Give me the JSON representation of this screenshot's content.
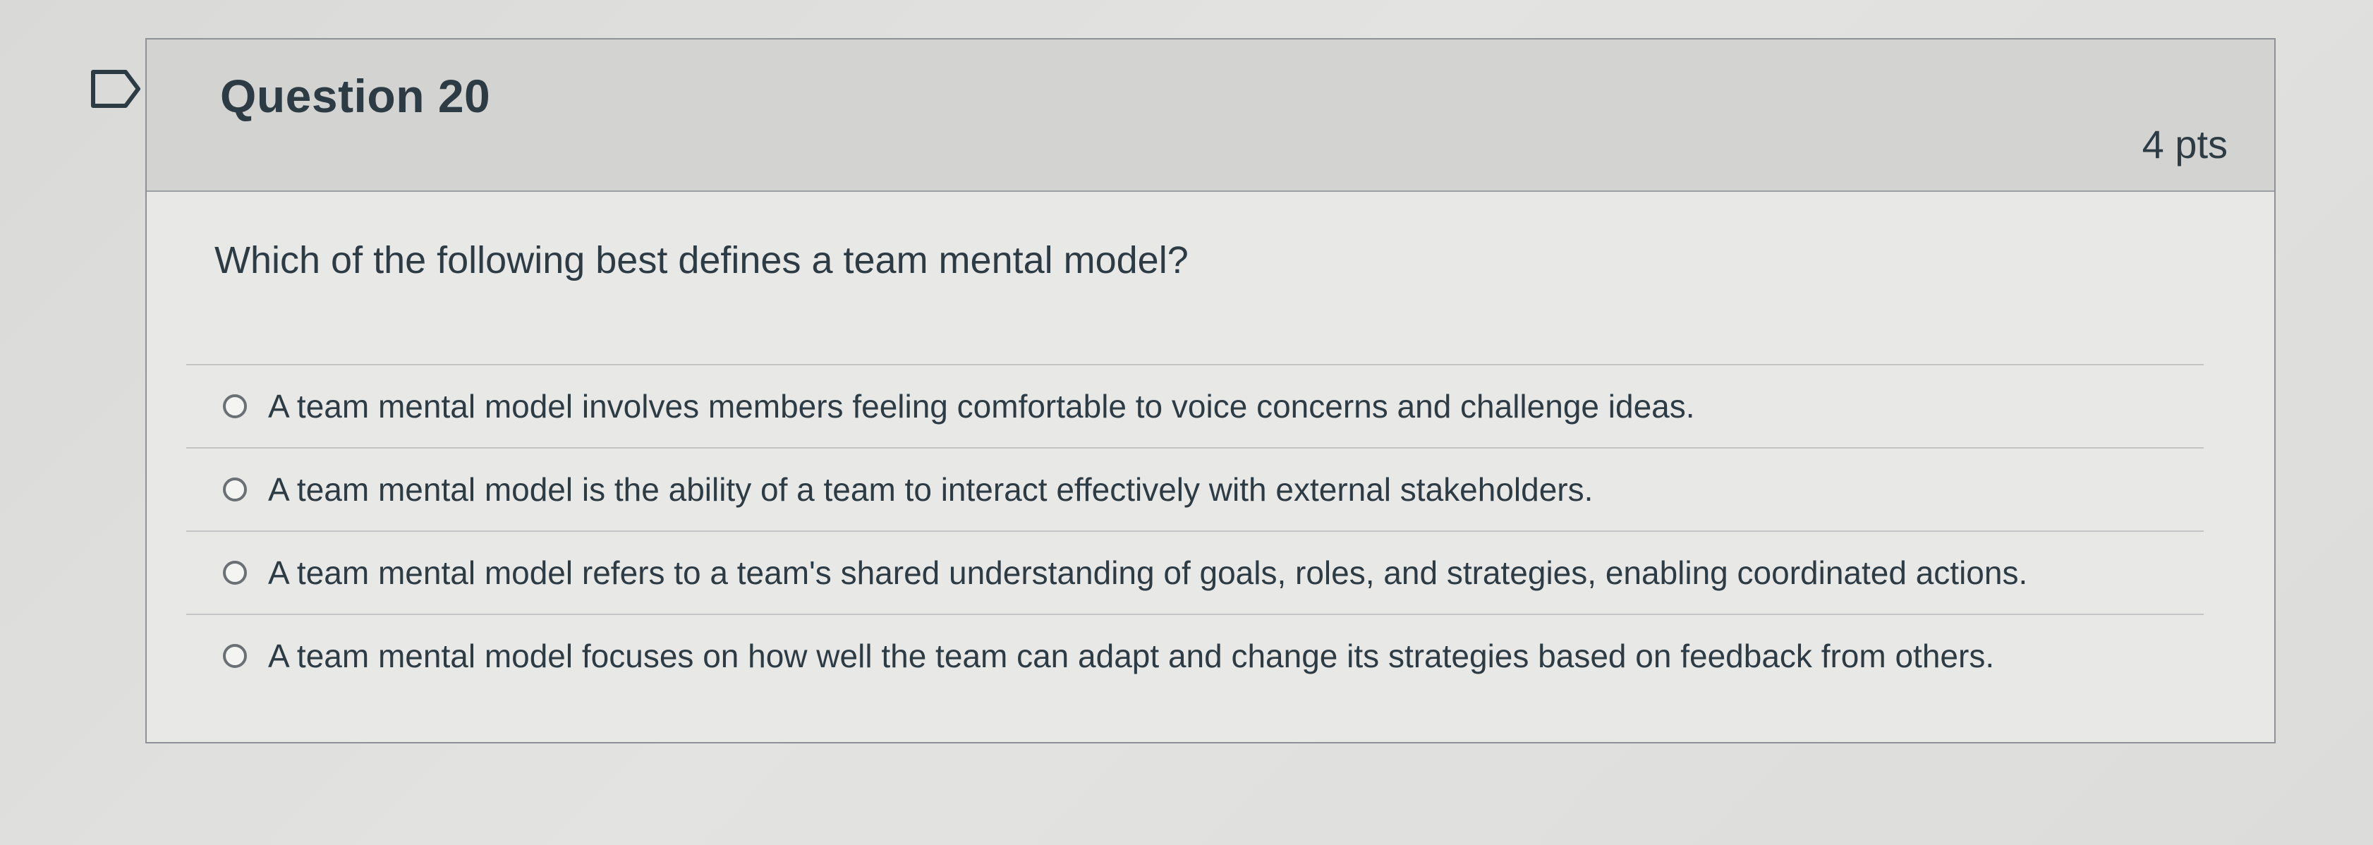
{
  "question": {
    "title": "Question 20",
    "points": "4 pts",
    "text": "Which of the following best defines a team mental model?",
    "answers": [
      "A team mental model involves members feeling comfortable to voice concerns and challenge ideas.",
      "A team mental model is the ability of a team to interact effectively with external stakeholders.",
      "A team mental model refers to a team's shared understanding of goals, roles, and strategies, enabling coordinated actions.",
      "A team mental model focuses on how well the team can adapt and change its strategies based on feedback from others."
    ]
  },
  "icons": {
    "flag": "flag-outline-icon",
    "radio": "radio-unselected-icon"
  },
  "colors": {
    "text": "#2d3b45",
    "header_bg": "#d3d3d1",
    "card_bg": "#e8e8e6",
    "border": "#8e9296"
  }
}
